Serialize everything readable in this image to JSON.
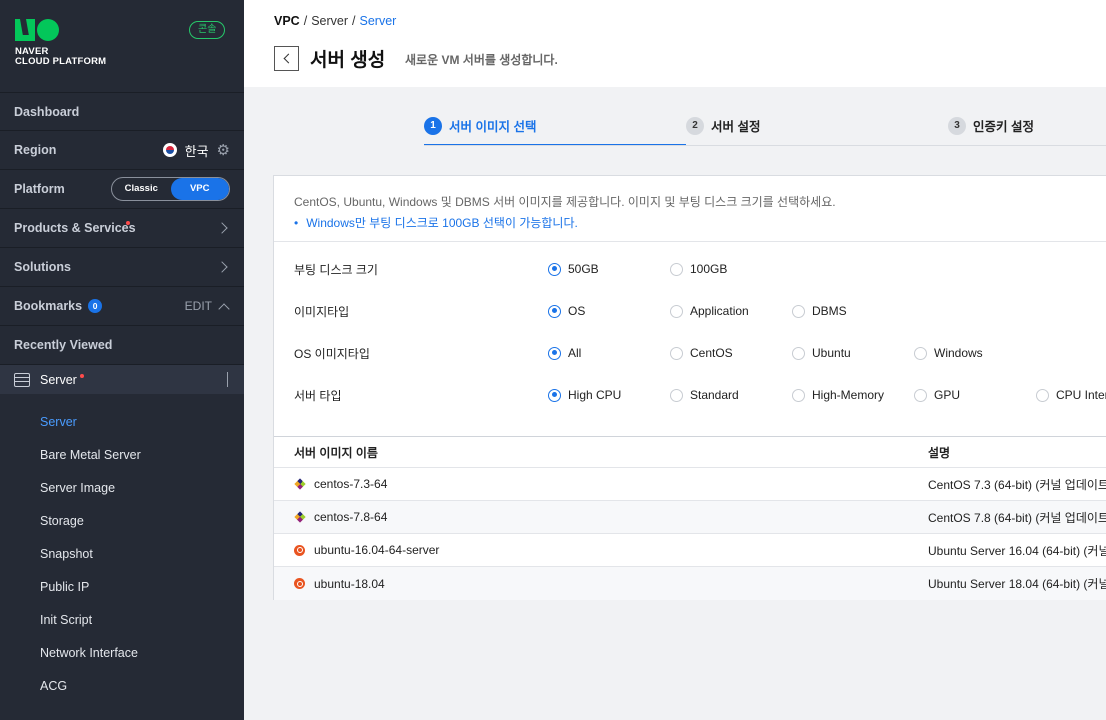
{
  "sidebar": {
    "logo_line1": "NAVER",
    "logo_line2": "CLOUD PLATFORM",
    "console_badge": "콘솔",
    "dashboard": "Dashboard",
    "region_label": "Region",
    "region_value": "한국",
    "platform_label": "Platform",
    "platform_options": [
      "Classic",
      "VPC"
    ],
    "platform_selected": "VPC",
    "products": "Products & Services",
    "solutions": "Solutions",
    "bookmarks": "Bookmarks",
    "bookmarks_count": "0",
    "edit": "EDIT",
    "recently_viewed": "Recently Viewed",
    "server_section": "Server",
    "server_items": [
      {
        "label": "Server",
        "active": true
      },
      {
        "label": "Bare Metal Server",
        "active": false
      },
      {
        "label": "Server Image",
        "active": false
      },
      {
        "label": "Storage",
        "active": false
      },
      {
        "label": "Snapshot",
        "active": false
      },
      {
        "label": "Public IP",
        "active": false
      },
      {
        "label": "Init Script",
        "active": false
      },
      {
        "label": "Network Interface",
        "active": false
      },
      {
        "label": "ACG",
        "active": false
      }
    ]
  },
  "header": {
    "breadcrumb": [
      "VPC",
      "Server",
      "Server"
    ],
    "title": "서버 생성",
    "subtitle": "새로운 VM 서버를 생성합니다."
  },
  "steps": [
    {
      "num": "1",
      "label": "서버 이미지 선택",
      "active": true
    },
    {
      "num": "2",
      "label": "서버 설정",
      "active": false
    },
    {
      "num": "3",
      "label": "인증키 설정",
      "active": false
    }
  ],
  "info": {
    "description": "CentOS, Ubuntu, Windows 및 DBMS 서버 이미지를 제공합니다. 이미지 및 부팅 디스크 크기를 선택하세요.",
    "note": "Windows만 부팅 디스크로 100GB 선택이 가능합니다."
  },
  "options": [
    {
      "label": "부팅 디스크 크기",
      "choices": [
        "50GB",
        "100GB"
      ],
      "selected": "50GB"
    },
    {
      "label": "이미지타입",
      "choices": [
        "OS",
        "Application",
        "DBMS"
      ],
      "selected": "OS"
    },
    {
      "label": "OS 이미지타입",
      "choices": [
        "All",
        "CentOS",
        "Ubuntu",
        "Windows"
      ],
      "selected": "All"
    },
    {
      "label": "서버 타입",
      "choices": [
        "High CPU",
        "Standard",
        "High-Memory",
        "GPU",
        "CPU Intensive"
      ],
      "selected": "High CPU"
    }
  ],
  "table": {
    "columns": [
      "서버 이미지 이름",
      "설명"
    ],
    "rows": [
      {
        "name": "centos-7.3-64",
        "icon": "centos-icon",
        "desc": "CentOS 7.3 (64-bit) (커널 업데이트"
      },
      {
        "name": "centos-7.8-64",
        "icon": "centos-icon",
        "desc": "CentOS 7.8 (64-bit) (커널 업데이트"
      },
      {
        "name": "ubuntu-16.04-64-server",
        "icon": "ubuntu-icon",
        "desc": "Ubuntu Server 16.04 (64-bit) (커널"
      },
      {
        "name": "ubuntu-18.04",
        "icon": "ubuntu-icon",
        "desc": "Ubuntu Server 18.04 (64-bit) (커널"
      }
    ]
  },
  "colors": {
    "accent": "#1a73e8",
    "sidebar_bg": "#252a35",
    "console_green": "#26c86a"
  }
}
